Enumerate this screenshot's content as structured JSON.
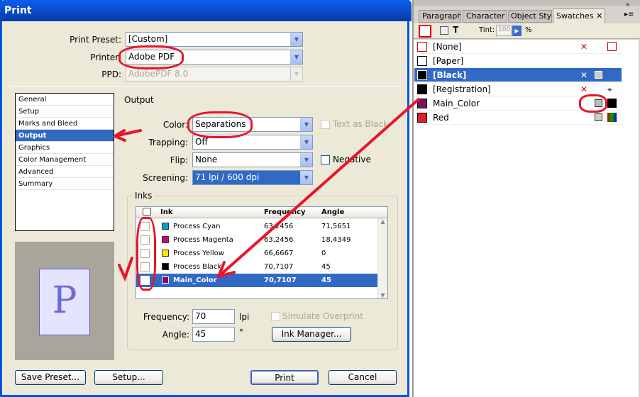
{
  "dialog": {
    "title": "Print",
    "print_preset_label": "Print Preset:",
    "print_preset_value": "[Custom]",
    "printer_label": "Printer:",
    "printer_value": "Adobe PDF",
    "ppd_label": "PPD:",
    "ppd_value": "AdobePDF 8.0",
    "categories": [
      "General",
      "Setup",
      "Marks and Bleed",
      "Output",
      "Graphics",
      "Color Management",
      "Advanced",
      "Summary"
    ],
    "active_category": "Output",
    "preview_letter": "P",
    "section_title": "Output",
    "color_label": "Color:",
    "color_value": "Separations",
    "text_as_black": "Text as Black",
    "trapping_label": "Trapping:",
    "trapping_value": "Off",
    "flip_label": "Flip:",
    "flip_value": "None",
    "negative": "Negative",
    "screening_label": "Screening:",
    "screening_value": "71 lpi / 600 dpi",
    "inks_title": "Inks",
    "ink_columns": [
      "Ink",
      "Frequency",
      "Angle"
    ],
    "inks": [
      {
        "name": "Process Cyan",
        "frequency": "63,2456",
        "angle": "71,5651",
        "color": "#00a0d6"
      },
      {
        "name": "Process Magenta",
        "frequency": "63,2456",
        "angle": "18,4349",
        "color": "#d6007d"
      },
      {
        "name": "Process Yellow",
        "frequency": "66,6667",
        "angle": "0",
        "color": "#ffe600"
      },
      {
        "name": "Process Black",
        "frequency": "70,7107",
        "angle": "45",
        "color": "#000000"
      },
      {
        "name": "Main_Color",
        "frequency": "70,7107",
        "angle": "45",
        "color": "#7a1060"
      }
    ],
    "frequency_label": "Frequency:",
    "frequency_value": "70",
    "frequency_unit": "lpi",
    "angle_label": "Angle:",
    "angle_value": "45",
    "angle_unit": "°",
    "simulate_overprint": "Simulate Overprint",
    "ink_manager": "Ink Manager...",
    "save_preset": "Save Preset...",
    "setup": "Setup...",
    "print": "Print",
    "cancel": "Cancel"
  },
  "panel": {
    "tabs": [
      "Paragraph S",
      "Character S",
      "Object Style",
      "Swatches"
    ],
    "active_tab": "Swatches",
    "tint_label": "Tint:",
    "tint_value": "100",
    "tint_unit": "%",
    "swatches": [
      {
        "name": "[None]",
        "color": "#ffffff"
      },
      {
        "name": "[Paper]",
        "color": "#ffffff"
      },
      {
        "name": "[Black]",
        "color": "#000000"
      },
      {
        "name": "[Registration]",
        "color": "#000000"
      },
      {
        "name": "Main_Color",
        "color": "#7a1060"
      },
      {
        "name": "Red",
        "color": "#e51e25"
      }
    ]
  },
  "colors": {
    "accent": "#316ac5",
    "title_blue": "#0054e3",
    "annotation_red": "#e8152b"
  }
}
